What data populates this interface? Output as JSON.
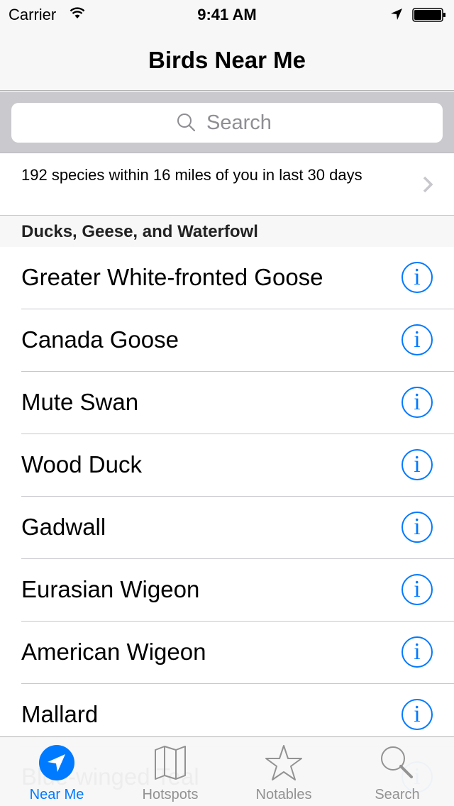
{
  "status_bar": {
    "carrier": "Carrier",
    "time": "9:41 AM",
    "icons": [
      "wifi-icon",
      "location-arrow-icon",
      "battery-icon"
    ]
  },
  "nav_bar": {
    "title": "Birds Near Me"
  },
  "search": {
    "placeholder": "Search",
    "value": "",
    "icon": "search-icon"
  },
  "summary": {
    "text": "192 species within 16 miles of you in last 30 days",
    "icon": "chevron-right-icon"
  },
  "section": {
    "title": "Ducks, Geese, and Waterfowl",
    "items": [
      {
        "name": "Greater White-fronted Goose"
      },
      {
        "name": "Canada Goose"
      },
      {
        "name": "Mute Swan"
      },
      {
        "name": "Wood Duck"
      },
      {
        "name": "Gadwall"
      },
      {
        "name": "Eurasian Wigeon"
      },
      {
        "name": "American Wigeon"
      },
      {
        "name": "Mallard"
      },
      {
        "name": "Blue-winged Teal"
      }
    ],
    "info_glyph": "i"
  },
  "tab_bar": {
    "active": "Near Me",
    "tabs": [
      {
        "label": "Near Me",
        "icon": "location-arrow-icon"
      },
      {
        "label": "Hotspots",
        "icon": "map-icon"
      },
      {
        "label": "Notables",
        "icon": "star-icon"
      },
      {
        "label": "Search",
        "icon": "search-icon"
      }
    ]
  },
  "colors": {
    "accent": "#007aff",
    "bar_background": "#f7f7f7",
    "search_area": "#c9c9ce",
    "separator": "#c8c7cc",
    "tab_inactive": "#929292"
  }
}
